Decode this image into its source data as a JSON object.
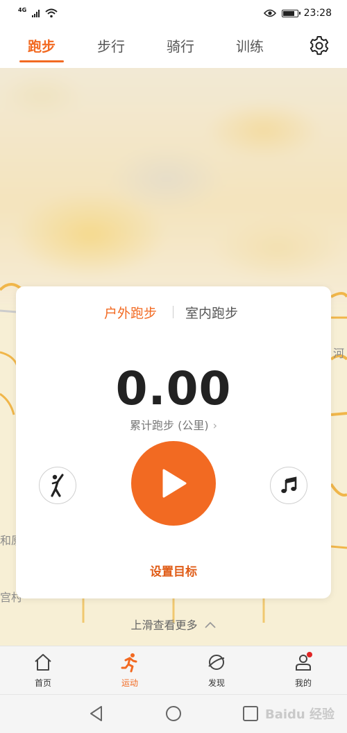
{
  "status_bar": {
    "network": "4G",
    "time": "23:28"
  },
  "tabs": [
    {
      "label": "跑步",
      "active": true
    },
    {
      "label": "步行",
      "active": false
    },
    {
      "label": "骑行",
      "active": false
    },
    {
      "label": "训练",
      "active": false
    }
  ],
  "map": {
    "labels": [
      "和原",
      "宫村",
      "河"
    ]
  },
  "card": {
    "modes": [
      {
        "label": "户外跑步",
        "active": true
      },
      {
        "label": "室内跑步",
        "active": false
      }
    ],
    "distance_value": "0.00",
    "distance_label": "累计跑步 (公里)",
    "goal_label": "设置目标"
  },
  "swipe_hint": "上滑查看更多",
  "bottom_nav": [
    {
      "label": "首页",
      "icon": "home-icon",
      "active": false
    },
    {
      "label": "运动",
      "icon": "running-icon",
      "active": true
    },
    {
      "label": "发现",
      "icon": "discover-icon",
      "active": false
    },
    {
      "label": "我的",
      "icon": "profile-icon",
      "active": false,
      "badge": true
    }
  ],
  "watermark": "Baidu 经验",
  "colors": {
    "accent": "#f26a22",
    "badge": "#e02525"
  }
}
